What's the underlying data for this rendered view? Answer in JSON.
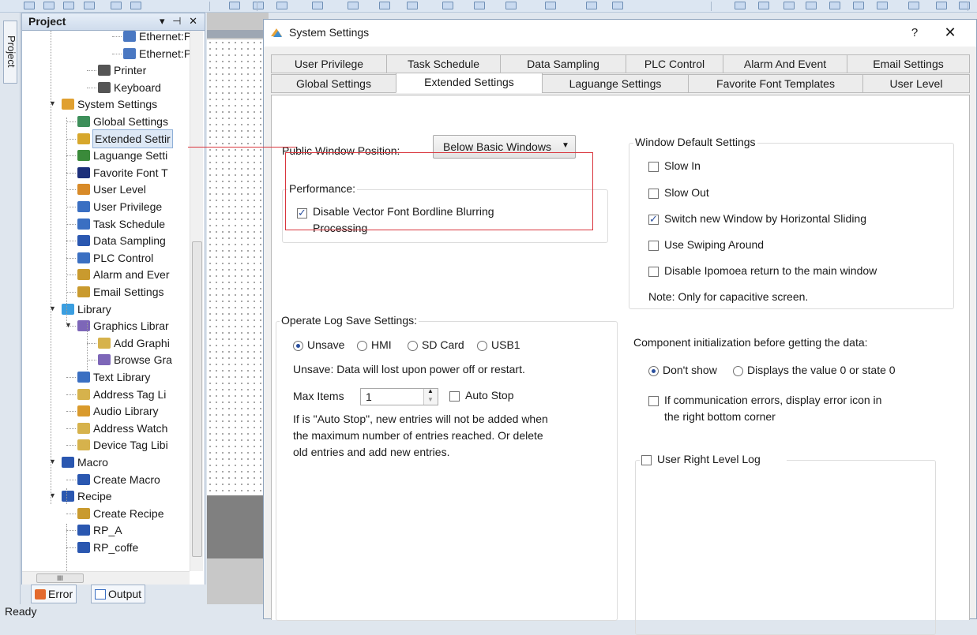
{
  "project_panel": {
    "title": "Project",
    "header_buttons": "▾ ⊣ ✕",
    "vertical_tab": "Project",
    "tree": [
      {
        "label": "Ethernet:Por",
        "icon": "monitor-icon",
        "color": "#4a78c2"
      },
      {
        "label": "Ethernet:Por",
        "icon": "monitor-icon",
        "color": "#4a78c2"
      },
      {
        "label": "Printer",
        "icon": "printer-icon",
        "color": "#555555"
      },
      {
        "label": "Keyboard",
        "icon": "keyboard-icon",
        "color": "#555555"
      },
      {
        "label": "System Settings",
        "icon": "gear-icon",
        "color": "#e0a030"
      },
      {
        "label": "Global Settings",
        "icon": "globe-gear-icon",
        "color": "#3d8f5a"
      },
      {
        "label": "Extended Settir",
        "icon": "extended-settings-icon",
        "color": "#d7a72c"
      },
      {
        "label": "Laguange Setti",
        "icon": "language-icon",
        "color": "#3a8a3a"
      },
      {
        "label": "Favorite Font T",
        "icon": "font-icon",
        "color": "#1c2f7a"
      },
      {
        "label": "User Level",
        "icon": "user-level-icon",
        "color": "#d88a28"
      },
      {
        "label": "User Privilege",
        "icon": "user-privilege-icon",
        "color": "#3a6fc2"
      },
      {
        "label": "Task Schedule",
        "icon": "calendar-icon",
        "color": "#3a6fc2"
      },
      {
        "label": "Data Sampling",
        "icon": "bar-chart-icon",
        "color": "#2a57b0"
      },
      {
        "label": "PLC Control",
        "icon": "plc-icon",
        "color": "#3a6fc2"
      },
      {
        "label": "Alarm and Ever",
        "icon": "alarm-icon",
        "color": "#c99a2e"
      },
      {
        "label": "Email Settings",
        "icon": "email-icon",
        "color": "#c99a2e"
      },
      {
        "label": "Library",
        "icon": "library-icon",
        "color": "#3a9ee0"
      },
      {
        "label": "Graphics Librar",
        "icon": "graphics-icon",
        "color": "#7d66b8"
      },
      {
        "label": "Add Graphi",
        "icon": "add-graphic-icon",
        "color": "#d6b24c"
      },
      {
        "label": "Browse Gra",
        "icon": "browse-graphic-icon",
        "color": "#7d66b8"
      },
      {
        "label": "Text Library",
        "icon": "text-library-icon",
        "color": "#3a6fc2"
      },
      {
        "label": "Address Tag Li",
        "icon": "tag-icon",
        "color": "#d6b24c"
      },
      {
        "label": "Audio Library",
        "icon": "audio-icon",
        "color": "#d99a2c"
      },
      {
        "label": "Address Watch",
        "icon": "tag-icon",
        "color": "#d6b24c"
      },
      {
        "label": "Device Tag Libi",
        "icon": "tag-icon",
        "color": "#d6b24c"
      },
      {
        "label": "Macro",
        "icon": "macro-icon",
        "color": "#2a57b0"
      },
      {
        "label": "Create Macro",
        "icon": "create-macro-icon",
        "color": "#2a57b0"
      },
      {
        "label": "Recipe",
        "icon": "recipe-icon",
        "color": "#2a57b0"
      },
      {
        "label": "Create Recipe",
        "icon": "create-recipe-icon",
        "color": "#c99a2e"
      },
      {
        "label": "RP_A",
        "icon": "recipe-item-icon",
        "color": "#2a57b0"
      },
      {
        "label": "RP_coffe",
        "icon": "recipe-item-icon",
        "color": "#2a57b0"
      }
    ],
    "hscroll_thumb": "III"
  },
  "bottom_tabs": {
    "error": "Error",
    "output": "Output"
  },
  "status": "Ready",
  "dialog": {
    "title": "System Settings",
    "help": "?",
    "close": "✕",
    "tabs_row1": [
      "User Privilege",
      "Task Schedule",
      "Data Sampling",
      "PLC Control",
      "Alarm And Event",
      "Email Settings"
    ],
    "tabs_row2": [
      "Global Settings",
      "Extended Settings",
      "Laguange Settings",
      "Favorite Font Templates",
      "User Level"
    ],
    "active_tab": "Extended Settings",
    "public_window_label": "Public Window Position:",
    "public_window_value": "Below Basic Windows",
    "performance": {
      "title": "Performance:",
      "disable_vector_line1": "Disable Vector Font Bordline Blurring",
      "disable_vector_line2": "Processing",
      "disable_vector_checked": true
    },
    "window_defaults": {
      "title": "Window Default Settings",
      "options": [
        {
          "label": "Slow In",
          "checked": false
        },
        {
          "label": "Slow Out",
          "checked": false
        },
        {
          "label": "Switch new Window by Horizontal Sliding",
          "checked": true
        },
        {
          "label": "Use Swiping Around",
          "checked": false
        },
        {
          "label": "Disable Ipomoea return to the main window",
          "checked": false
        }
      ],
      "note": "Note: Only for capacitive screen."
    },
    "operate_log": {
      "title": "Operate Log Save Settings:",
      "radios": [
        "Unsave",
        "HMI",
        "SD Card",
        "USB1"
      ],
      "selected": "Unsave",
      "unsave_note": "Unsave: Data will lost upon power off or restart.",
      "max_items_label": "Max Items",
      "max_items_value": "1",
      "auto_stop_label": "Auto Stop",
      "auto_stop_checked": false,
      "help_line1": "If is \"Auto Stop\", new entries will not be added when",
      "help_line2": "the maximum number of entries reached. Or delete",
      "help_line3": "old entries and add new entries."
    },
    "component_init": {
      "label": "Component initialization before getting the data:",
      "radios": [
        "Don't show",
        "Displays the value 0 or state 0"
      ],
      "selected": "Don't show",
      "comm_error_line1": "If communication errors, display error icon in",
      "comm_error_line2": "the right bottom corner",
      "comm_error_checked": false
    },
    "user_right_log": {
      "label": "User Right  Level Log",
      "checked": false
    }
  }
}
